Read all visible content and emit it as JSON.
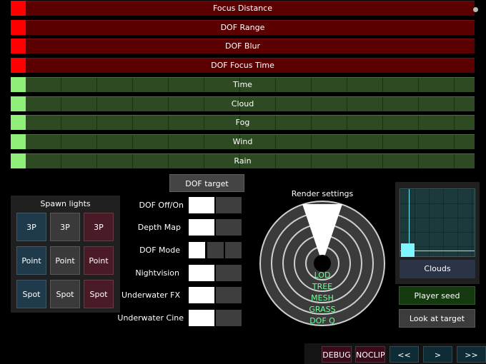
{
  "sliders": {
    "focus_distance": "Focus Distance",
    "dof_range": "DOF Range",
    "dof_blur": "DOF Blur",
    "dof_focus_time": "DOF Focus Time",
    "time": "Time",
    "cloud": "Cloud",
    "fog": "Fog",
    "wind": "Wind",
    "rain": "Rain"
  },
  "spawn_lights": {
    "title": "Spawn lights",
    "row1": [
      "3P",
      "3P",
      "3P"
    ],
    "row2": [
      "Point",
      "Point",
      "Point"
    ],
    "row3": [
      "Spot",
      "Spot",
      "Spot"
    ]
  },
  "dof": {
    "target_button": "DOF target",
    "rows": [
      "DOF Off/On",
      "Depth Map",
      "DOF Mode",
      "Nightvision",
      "Underwater FX",
      "Underwater Cine"
    ]
  },
  "render": {
    "title": "Render settings",
    "levels": [
      "LOD",
      "TREE",
      "MESH",
      "GRASS",
      "DOF Q"
    ]
  },
  "right": {
    "clouds_button": "Clouds",
    "player_seed_button": "Player seed",
    "look_at_target_button": "Look at target"
  },
  "bottom": {
    "debug": "DEBUG",
    "noclip": "NOCLIP",
    "prev_prev": "<<",
    "prev": ">",
    "next": ">>"
  },
  "colors": {
    "red_track": "#5a0000",
    "red_handle": "#ff0000",
    "green_track": "#2d4a22",
    "green_handle": "#8fef7a",
    "accent_cyan": "#6fefff",
    "radar_label": "#6fff9a"
  }
}
